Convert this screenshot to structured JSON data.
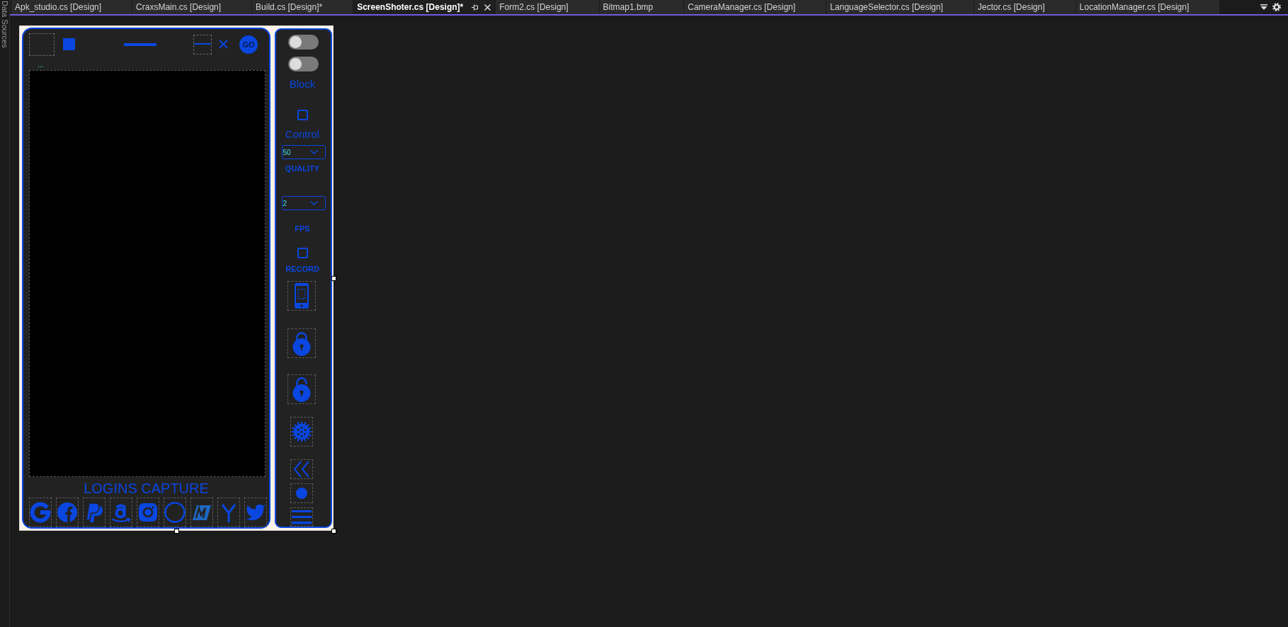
{
  "side_tab": {
    "label": "Data Sources"
  },
  "tabs": [
    {
      "label": "Apk_studio.cs [Design]",
      "selected": false
    },
    {
      "label": "CraxsMain.cs [Design]",
      "selected": false
    },
    {
      "label": "Build.cs [Design]*",
      "selected": false
    },
    {
      "label": "ScreenShoter.cs [Design]*",
      "selected": true
    },
    {
      "label": "Form2.cs [Design]",
      "selected": false
    },
    {
      "label": "Bitmap1.bmp",
      "selected": false
    },
    {
      "label": "CameraManager.cs [Design]",
      "selected": false
    },
    {
      "label": "LanguageSelector.cs [Design]",
      "selected": false
    },
    {
      "label": "Jector.cs [Design]",
      "selected": false
    },
    {
      "label": "LocationManager.cs [Design]",
      "selected": false
    }
  ],
  "viewer": {
    "go_button": {
      "label": "GO"
    },
    "status_text": "...",
    "title": "LOGINS CAPTURE"
  },
  "side_controls": {
    "toggles": [
      {
        "on": false
      },
      {
        "on": false
      }
    ],
    "block_label": "Block",
    "control": {
      "checked": false,
      "label": "Control"
    },
    "quality": {
      "value": "50",
      "label": "QUALITY"
    },
    "fps": {
      "value": "2",
      "label": "FPS"
    },
    "record": {
      "checked": false,
      "label": "RECORD"
    }
  }
}
